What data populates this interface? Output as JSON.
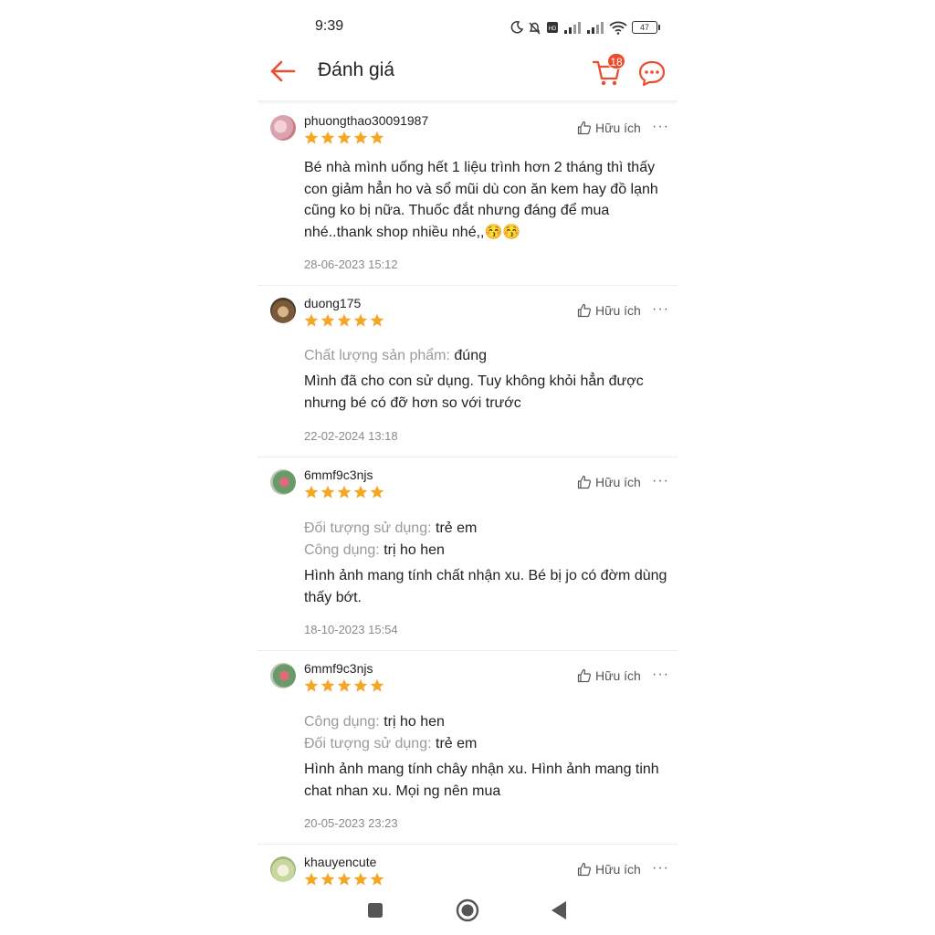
{
  "status_bar": {
    "time": "9:39",
    "battery": "47",
    "icons": [
      "moon-icon",
      "bell-off-icon",
      "volte-icon",
      "signal-icon",
      "signal-icon",
      "wifi-icon",
      "battery-icon"
    ]
  },
  "header": {
    "title": "Đánh giá",
    "cart_count": "18",
    "accent_color": "#ee4d2d"
  },
  "reviews": [
    {
      "username": "phuongthao30091987",
      "rating": 5,
      "helpful_label": "Hữu ích",
      "more_label": "···",
      "attributes": [],
      "text": "Bé nhà mình uống hết 1 liệu trình hơn 2 tháng thì thấy con giảm hẳn ho và sổ mũi dù con ăn kem hay đồ lạnh cũng ko bị nữa. Thuốc đắt nhưng đáng để mua nhé..thank shop nhiều nhé,,😚😚",
      "date": "28-06-2023 15:12"
    },
    {
      "username": "duong175",
      "rating": 5,
      "helpful_label": "Hữu ích",
      "more_label": "···",
      "attributes": [
        {
          "key": "Chất lượng sản phẩm:",
          "value": "đúng"
        }
      ],
      "text": "Mình đã cho con sử dụng. Tuy không khỏi hẳn được nhưng bé có đỡ hơn so với trước",
      "date": "22-02-2024 13:18"
    },
    {
      "username": "6mmf9c3njs",
      "rating": 5,
      "helpful_label": "Hữu ích",
      "more_label": "···",
      "attributes": [
        {
          "key": "Đối tượng sử dụng:",
          "value": "trẻ em"
        },
        {
          "key": "Công dụng:",
          "value": "trị ho hen"
        }
      ],
      "text": "Hình ảnh mang tính chất nhận xu. Bé bị jo có đờm dùng thấy bớt.",
      "date": "18-10-2023 15:54"
    },
    {
      "username": "6mmf9c3njs",
      "rating": 5,
      "helpful_label": "Hữu ích",
      "more_label": "···",
      "attributes": [
        {
          "key": "Công dụng:",
          "value": "trị ho hen"
        },
        {
          "key": "Đối tượng sử dụng:",
          "value": "trẻ em"
        }
      ],
      "text": "Hình ảnh mang tính chây nhận xu. Hình ảnh mang tinh chat nhan xu. Mọi ng nên mua",
      "date": "20-05-2023 23:23"
    },
    {
      "username": "khauyencute",
      "rating": 5,
      "helpful_label": "Hữu ích",
      "more_label": "···",
      "attributes": [],
      "text": "",
      "date": ""
    }
  ],
  "nav_bar": {
    "buttons": [
      "recents-square-icon",
      "home-circle-icon",
      "back-triangle-icon"
    ]
  }
}
